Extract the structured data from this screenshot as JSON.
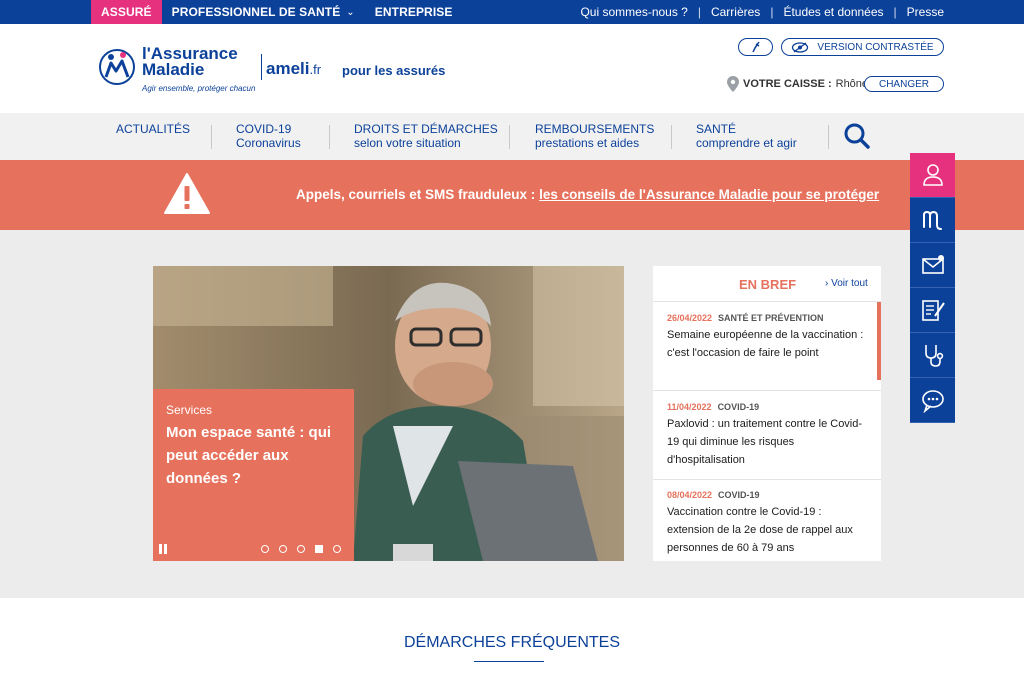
{
  "topbar": {
    "tabs": [
      {
        "label": "ASSURÉ"
      },
      {
        "label": "PROFESSIONNEL DE SANTÉ"
      },
      {
        "label": "ENTREPRISE"
      }
    ],
    "links": [
      "Qui sommes-nous ?",
      "Carrières",
      "Études et données",
      "Presse"
    ]
  },
  "header": {
    "logo_line1": "l'Assurance",
    "logo_line2": "Maladie",
    "logo_tagline": "Agir ensemble, protéger chacun",
    "site_name": "ameli",
    "site_tld": ".fr",
    "audience": "pour les assurés",
    "contrast_label": "VERSION CONTRASTÉE",
    "caisse_label": "VOTRE CAISSE :",
    "caisse_value": "Rhône",
    "change_label": "CHANGER"
  },
  "nav": {
    "items": [
      {
        "line1": "ACTUALITÉS",
        "line2": ""
      },
      {
        "line1": "COVID-19",
        "line2": "Coronavirus"
      },
      {
        "line1": "DROITS ET DÉMARCHES",
        "line2": "selon votre situation"
      },
      {
        "line1": "REMBOURSEMENTS",
        "line2": "prestations et aides"
      },
      {
        "line1": "SANTÉ",
        "line2": "comprendre et agir"
      }
    ]
  },
  "alert": {
    "text": "Appels, courriels et SMS frauduleux :",
    "link": "les conseils de l'Assurance Maladie pour se protéger"
  },
  "hero": {
    "kicker": "Services",
    "title": "Mon espace santé : qui peut accéder aux données ?",
    "slide_count": 5,
    "active_slide": 4
  },
  "brief": {
    "title": "EN BREF",
    "see_all": "Voir tout",
    "items": [
      {
        "date": "26/04/2022",
        "category": "SANTÉ ET PRÉVENTION",
        "text": "Semaine européenne de la vaccination : c'est l'occasion de faire le point"
      },
      {
        "date": "11/04/2022",
        "category": "COVID-19",
        "text": "Paxlovid : un traitement contre le Covid-19 qui diminue les risques d'hospitalisation"
      },
      {
        "date": "08/04/2022",
        "category": "COVID-19",
        "text": "Vaccination contre le Covid-19 : extension de la 2e dose de rappel aux personnes de 60 à 79 ans"
      }
    ]
  },
  "section": {
    "title": "DÉMARCHES FRÉQUENTES"
  },
  "colors": {
    "brand_blue": "#0c419a",
    "brand_pink": "#e6317f",
    "coral": "#e6715c"
  }
}
